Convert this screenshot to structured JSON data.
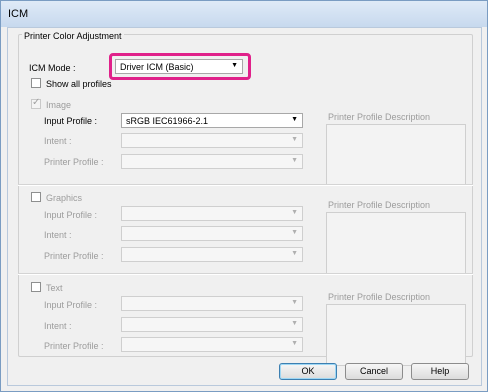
{
  "window": {
    "title": "ICM"
  },
  "group": {
    "title": "Printer Color Adjustment"
  },
  "icm_mode": {
    "label": "ICM Mode :",
    "value": "Driver ICM (Basic)"
  },
  "show_all_profiles": {
    "label": "Show all profiles",
    "checked": false
  },
  "sections": [
    {
      "title": "Image",
      "checked": true,
      "input_label": "Input Profile :",
      "input_value": "sRGB IEC61966-2.1",
      "intent_label": "Intent :",
      "printer_label": "Printer Profile :",
      "desc_label": "Printer Profile Description"
    },
    {
      "title": "Graphics",
      "checked": false,
      "input_label": "Input Profile :",
      "intent_label": "Intent :",
      "printer_label": "Printer Profile :",
      "desc_label": "Printer Profile Description"
    },
    {
      "title": "Text",
      "checked": false,
      "input_label": "Input Profile :",
      "intent_label": "Intent :",
      "printer_label": "Printer Profile :",
      "desc_label": "Printer Profile Description"
    }
  ],
  "buttons": {
    "ok": "OK",
    "cancel": "Cancel",
    "help": "Help"
  },
  "colors": {
    "highlight": "#e0218a"
  }
}
